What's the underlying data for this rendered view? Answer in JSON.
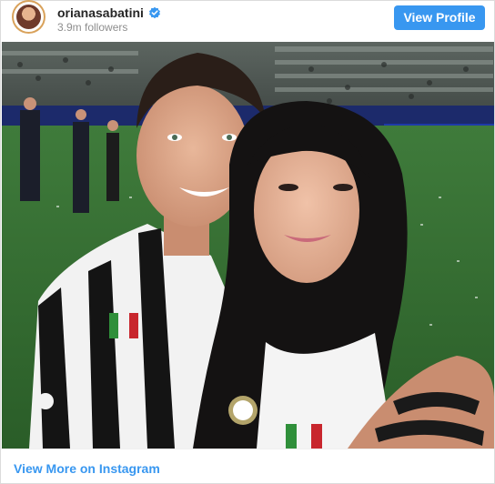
{
  "profile": {
    "username": "orianasabatini",
    "followers": "3.9m followers",
    "verified": true,
    "view_profile_label": "View Profile"
  },
  "post": {
    "image_label": "Instagram photo"
  },
  "footer": {
    "view_more_label": "View More on Instagram"
  },
  "colors": {
    "accent": "#3897f0",
    "username": "#262626",
    "muted": "#8e8e8e"
  },
  "icons": {
    "verified": "verified-badge-icon"
  }
}
